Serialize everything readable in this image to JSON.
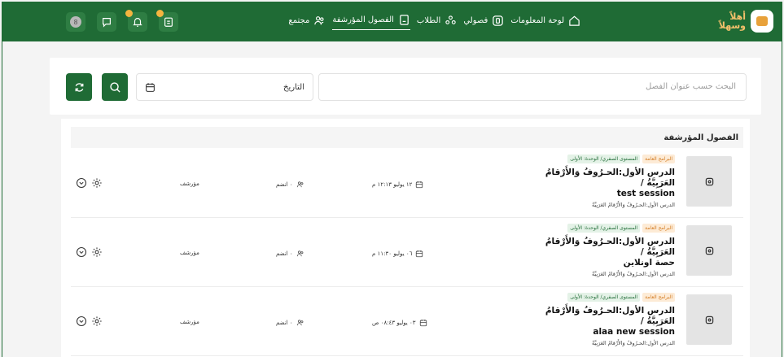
{
  "header": {
    "logo_text_top": "أهلاً",
    "logo_text_bottom": "وسهلاً",
    "nav": [
      {
        "label": "لوحة المعلومات",
        "icon": "home-icon",
        "active": false
      },
      {
        "label": "فصولي",
        "icon": "class-icon",
        "active": false
      },
      {
        "label": "الطلاب",
        "icon": "students-icon",
        "active": false
      },
      {
        "label": "الفصول المؤرشفة",
        "icon": "archive-icon",
        "active": true
      },
      {
        "label": "مجتمع",
        "icon": "community-icon",
        "active": false
      }
    ],
    "avatar_initial": "8"
  },
  "search": {
    "placeholder": "البحث حسب عنوان الفصل",
    "date_label": "التاريخ"
  },
  "list": {
    "heading": "الفصول المؤرشفة",
    "rows": [
      {
        "tag_program": "البرامج العامة",
        "tag_level": "المستوى الصفري/ الوحدة: الأولى",
        "title_ar": "الدرس الأول:الحـرُوفُ وَالأَرْقامُ العَرَبِيَّةُ /",
        "title_en": "test session",
        "subtitle": "الدرس الأول:الحـرُوفُ وَالأَرْقامُ العَرَبِيَّةُ",
        "date": "١٢ يوليو ١٢:١٣ م",
        "joined": "٠ انضم",
        "status": "مؤرشف"
      },
      {
        "tag_program": "البرامج العامة",
        "tag_level": "المستوى الصفري/ الوحدة: الأولى",
        "title_ar": "الدرس الأول:الحـرُوفُ وَالأَرْقامُ العَرَبِيَّةُ /",
        "title_en": "حصة اونلاين",
        "subtitle": "الدرس الأول:الحـرُوفُ وَالأَرْقامُ العَرَبِيَّةُ",
        "date": "٠٦ يوليو ١١:٣٠ م",
        "joined": "٠ انضم",
        "status": "مؤرشف"
      },
      {
        "tag_program": "البرامج العامة",
        "tag_level": "المستوى الصفري/ الوحدة: الأولى",
        "title_ar": "الدرس الأول:الحـرُوفُ وَالأَرْقامُ العَرَبِيَّةُ /",
        "title_en": "alaa new session",
        "subtitle": "الدرس الأول:الحـرُوفُ وَالأَرْقامُ العَرَبِيَّةُ",
        "date": "٠٣ يوليو ٠٨:٤٣ ص",
        "joined": "٠ انضم",
        "status": "مؤرشف"
      }
    ]
  },
  "colors": {
    "primary": "#1f6b35",
    "accent": "#f4b43f",
    "tag_orange": "#d27a20"
  }
}
